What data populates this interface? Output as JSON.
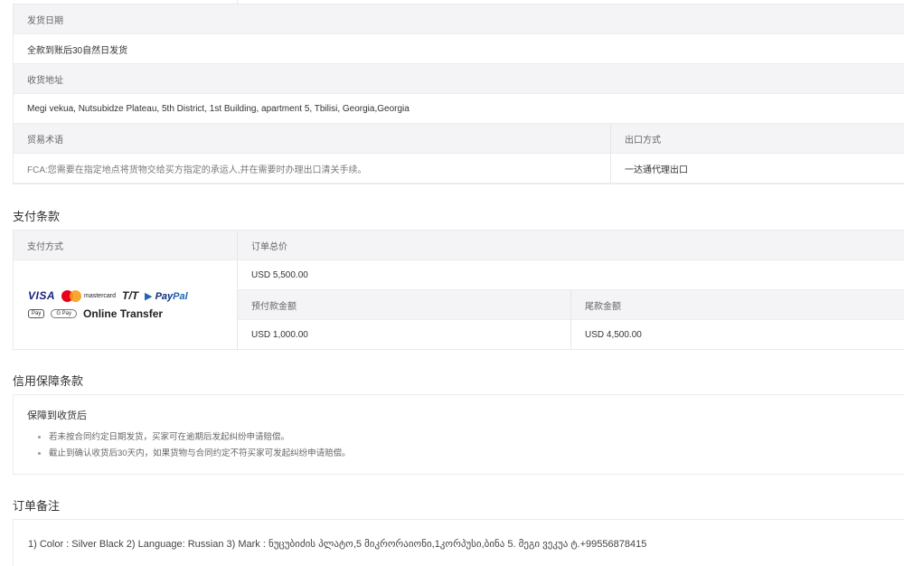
{
  "shipping": {
    "ship_date_label": "发货日期",
    "ship_date_value": "全款到账后30自然日发货",
    "address_label": "收货地址",
    "address_value": "Megi vekua, Nutsubidze Plateau, 5th District, 1st Building, apartment 5, Tbilisi, Georgia,Georgia",
    "trade_terms_label": "贸易术语",
    "trade_terms_value": "FCA:您需要在指定地点将货物交给买方指定的承运人,并在需要时办理出口清关手续。",
    "export_label": "出口方式",
    "export_value": "一达通代理出口"
  },
  "payment": {
    "title": "支付条款",
    "method_label": "支付方式",
    "total_label": "订单总价",
    "total_value": "USD 5,500.00",
    "deposit_label": "预付款金额",
    "deposit_value": "USD 1,000.00",
    "balance_label": "尾款金额",
    "balance_value": "USD 4,500.00",
    "methods": {
      "visa": "VISA",
      "mastercard": "mastercard",
      "tt": "T/T",
      "paypal_a": "Pay",
      "paypal_b": "Pal",
      "applepay": "Pay",
      "googlepay": "G Pay",
      "online": "Online Transfer"
    }
  },
  "credit": {
    "title": "信用保障条款",
    "subtitle": "保障到收货后",
    "items": [
      "若未按合同约定日期发货，买家可在逾期后发起纠纷申请赔偿。",
      "截止到确认收货后30天内，如果货物与合同约定不符买家可发起纠纷申请赔偿。"
    ]
  },
  "notes": {
    "title": "订单备注",
    "text": "1) Color : Silver Black 2) Language: Russian 3) Mark : ნუცუბიძის პლატო,5 მიკრორაიონი,1კორპუსი,ბინა 5. მეგი ვეკუა ტ.+99556878415"
  }
}
